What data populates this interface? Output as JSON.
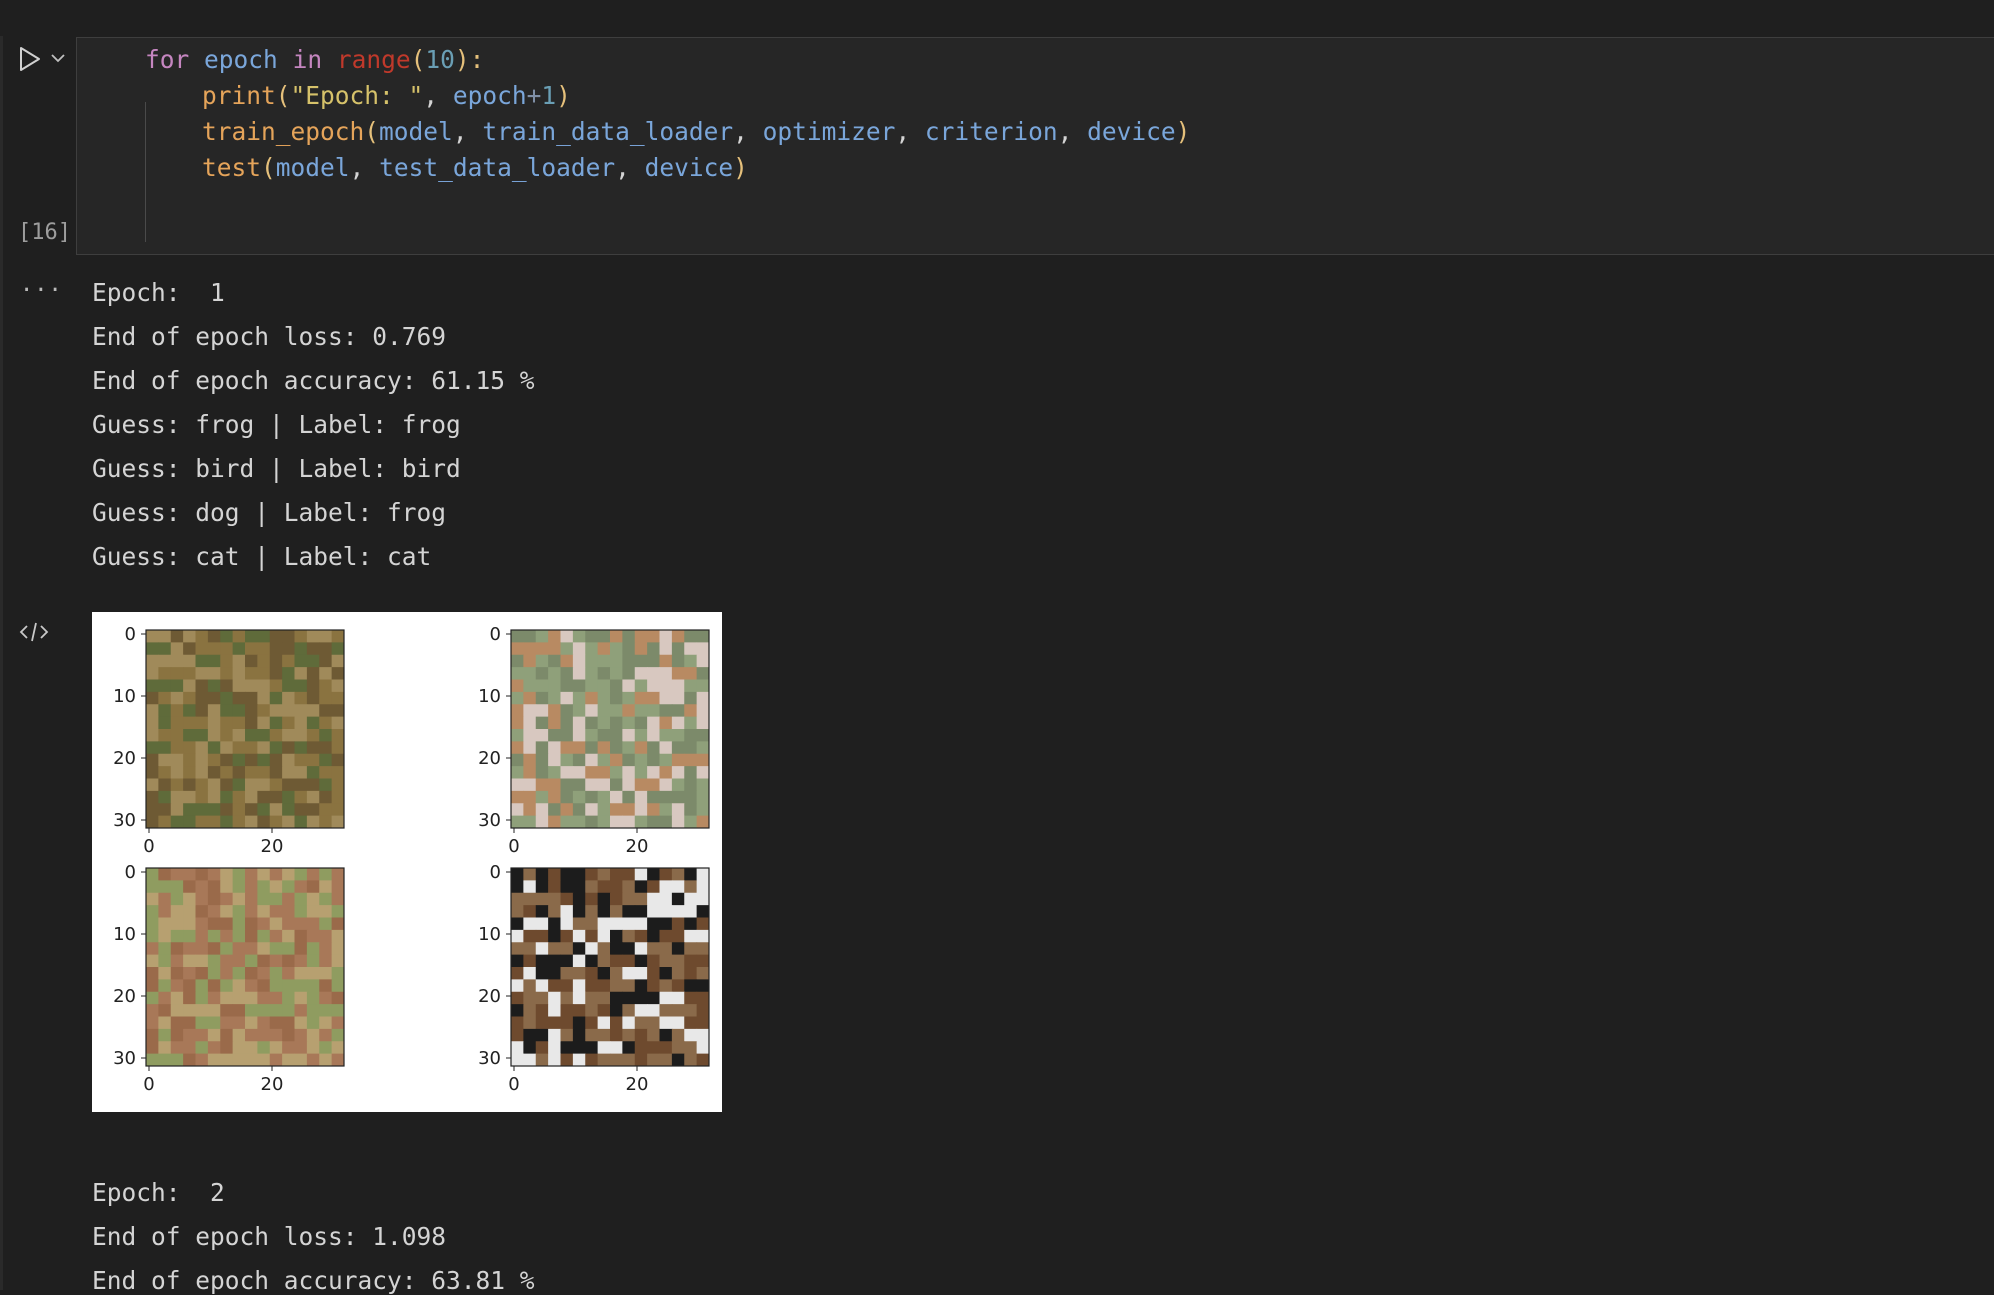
{
  "cell": {
    "execution_count": "[16]",
    "code_lines": [
      [
        {
          "t": "for",
          "c": "kw"
        },
        {
          "t": " ",
          "c": "punc"
        },
        {
          "t": "epoch",
          "c": "var"
        },
        {
          "t": " ",
          "c": "punc"
        },
        {
          "t": "in",
          "c": "kw"
        },
        {
          "t": " ",
          "c": "punc"
        },
        {
          "t": "range",
          "c": "builtin"
        },
        {
          "t": "(",
          "c": "paren"
        },
        {
          "t": "10",
          "c": "num"
        },
        {
          "t": "):",
          "c": "paren"
        }
      ],
      [
        {
          "t": "print",
          "c": "fn"
        },
        {
          "t": "(",
          "c": "paren"
        },
        {
          "t": "\"Epoch: \"",
          "c": "str"
        },
        {
          "t": ", ",
          "c": "punc"
        },
        {
          "t": "epoch",
          "c": "var"
        },
        {
          "t": "+",
          "c": "op"
        },
        {
          "t": "1",
          "c": "num"
        },
        {
          "t": ")",
          "c": "paren"
        }
      ],
      [
        {
          "t": "train_epoch",
          "c": "fn"
        },
        {
          "t": "(",
          "c": "paren"
        },
        {
          "t": "model",
          "c": "var"
        },
        {
          "t": ", ",
          "c": "punc"
        },
        {
          "t": "train_data_loader",
          "c": "var"
        },
        {
          "t": ", ",
          "c": "punc"
        },
        {
          "t": "optimizer",
          "c": "var"
        },
        {
          "t": ", ",
          "c": "punc"
        },
        {
          "t": "criterion",
          "c": "var"
        },
        {
          "t": ", ",
          "c": "punc"
        },
        {
          "t": "device",
          "c": "var"
        },
        {
          "t": ")",
          "c": "paren"
        }
      ],
      [
        {
          "t": "test",
          "c": "fn"
        },
        {
          "t": "(",
          "c": "paren"
        },
        {
          "t": "model",
          "c": "var"
        },
        {
          "t": ", ",
          "c": "punc"
        },
        {
          "t": "test_data_loader",
          "c": "var"
        },
        {
          "t": ", ",
          "c": "punc"
        },
        {
          "t": "device",
          "c": "var"
        },
        {
          "t": ")",
          "c": "paren"
        }
      ]
    ]
  },
  "output": {
    "more_glyph": "···",
    "epoch1_lines": [
      "Epoch:  1",
      "End of epoch loss: 0.769",
      "End of epoch accuracy: 61.15 %",
      "Guess: frog | Label: frog",
      "Guess: bird | Label: bird",
      "Guess: dog | Label: frog",
      "Guess: cat | Label: cat"
    ],
    "epoch2_lines": [
      "Epoch:  2",
      "End of epoch loss: 1.098",
      "End of epoch accuracy: 63.81 %"
    ]
  },
  "figure": {
    "y_ticks": [
      "0",
      "10",
      "20",
      "30"
    ],
    "x_ticks": [
      "0",
      "20"
    ],
    "images": [
      {
        "subject": "frog",
        "colors": [
          "#8a7340",
          "#5f6b3a",
          "#a08a5a",
          "#6e5a34"
        ]
      },
      {
        "subject": "bird",
        "colors": [
          "#8fa07a",
          "#b88a62",
          "#7c8a6a",
          "#d8c8c0"
        ]
      },
      {
        "subject": "frog",
        "colors": [
          "#a87858",
          "#8f9c60",
          "#9a6a4a",
          "#b7a070"
        ]
      },
      {
        "subject": "cat",
        "colors": [
          "#6e4a2e",
          "#1c1c1c",
          "#e8e8e8",
          "#8a6a4a"
        ]
      }
    ]
  },
  "icons": {
    "run": "run-icon",
    "caret": "chevron-down-icon",
    "more": "more-horizontal-icon",
    "code": "code-icon"
  }
}
